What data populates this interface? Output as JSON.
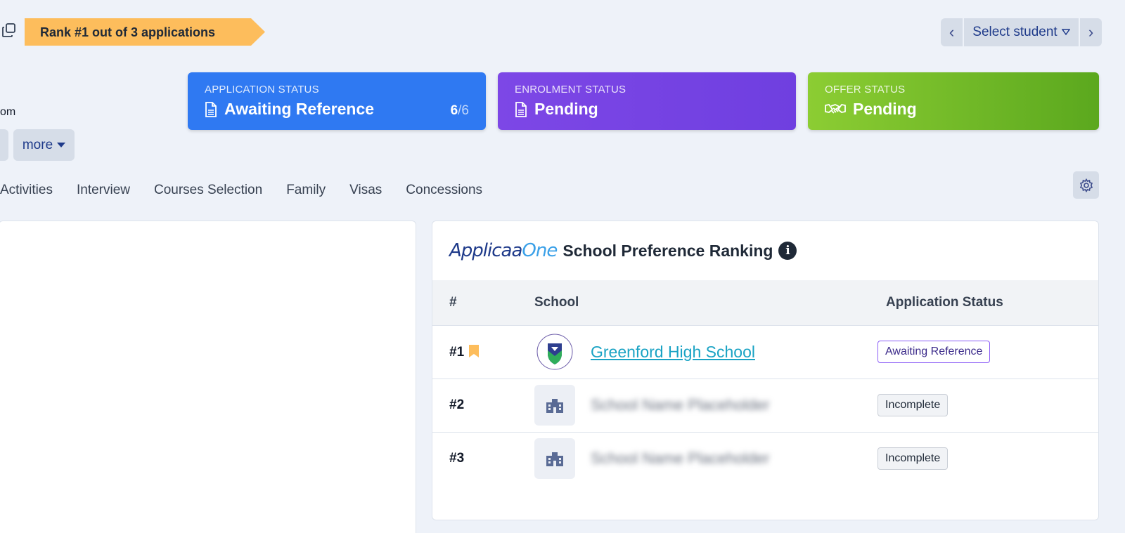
{
  "rank_badge": {
    "text": "Rank #1 out of 3 applications",
    "color": "#fdbd5c"
  },
  "student_nav": {
    "select_label": "Select student"
  },
  "cards": {
    "application": {
      "label": "APPLICATION STATUS",
      "value": "Awaiting Reference",
      "count": "6",
      "total": "/6",
      "color": "#2f79f2"
    },
    "enrolment": {
      "label": "ENROLMENT STATUS",
      "value": "Pending",
      "color": "#7d47e6"
    },
    "offer": {
      "label": "OFFER STATUS",
      "value": "Pending",
      "color": "#6fb827"
    }
  },
  "email_fragment": "om",
  "more_button": {
    "label": "more"
  },
  "tabs": [
    "Activities",
    "Interview",
    "Courses Selection",
    "Family",
    "Visas",
    "Concessions"
  ],
  "ranking_panel": {
    "logo_part1": "Applicaa",
    "logo_part2": "One",
    "title": "School Preference Ranking",
    "columns": {
      "rank": "#",
      "school": "School",
      "status": "Application Status"
    },
    "rows": [
      {
        "rank": "#1",
        "school": "Greenford High School",
        "status": "Awaiting Reference"
      },
      {
        "rank": "#2",
        "school": "School Name Placeholder",
        "status": "Incomplete"
      },
      {
        "rank": "#3",
        "school": "School Name Placeholder",
        "status": "Incomplete"
      }
    ]
  }
}
